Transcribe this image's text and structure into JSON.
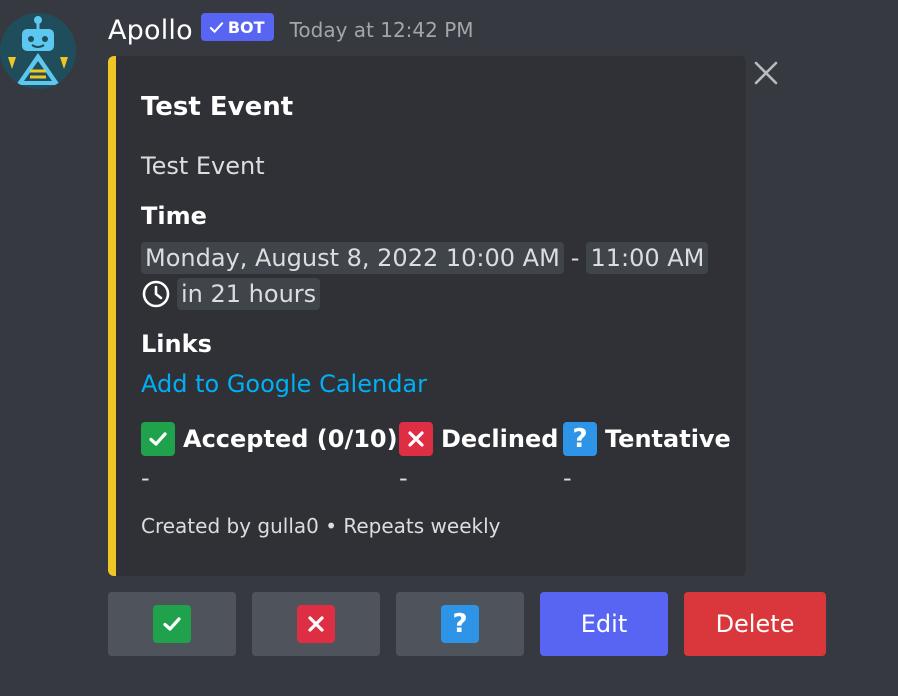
{
  "message": {
    "username": "Apollo",
    "bot_badge": "BOT",
    "timestamp": "Today at 12:42 PM",
    "avatar_icon": "robot-avatar-icon"
  },
  "embed": {
    "accent_color": "#f0c526",
    "title": "Test Event",
    "description": "Test Event",
    "time_label": "Time",
    "time_start": "Monday, August 8, 2022 10:00 AM",
    "time_separator": "-",
    "time_end": "11:00 AM",
    "relative_time": "in 21 hours",
    "links_label": "Links",
    "calendar_link": "Add to Google Calendar",
    "rsvp": [
      {
        "label": "Accepted (0/10)",
        "value": "-",
        "icon": "check-emoji-icon"
      },
      {
        "label": "Declined",
        "value": "-",
        "icon": "cross-emoji-icon"
      },
      {
        "label": "Tentative",
        "value": "-",
        "icon": "question-emoji-icon"
      }
    ],
    "footer": "Created by gulla0 • Repeats weekly"
  },
  "buttons": {
    "accept_icon": "check-emoji-icon",
    "decline_icon": "cross-emoji-icon",
    "tentative_icon": "question-emoji-icon",
    "tentative_glyph": "?",
    "edit": "Edit",
    "delete": "Delete"
  },
  "colors": {
    "background": "#36393f",
    "embed_bg": "#2f3136",
    "blurple": "#5865f2",
    "danger": "#da373c",
    "link": "#00aff4"
  }
}
